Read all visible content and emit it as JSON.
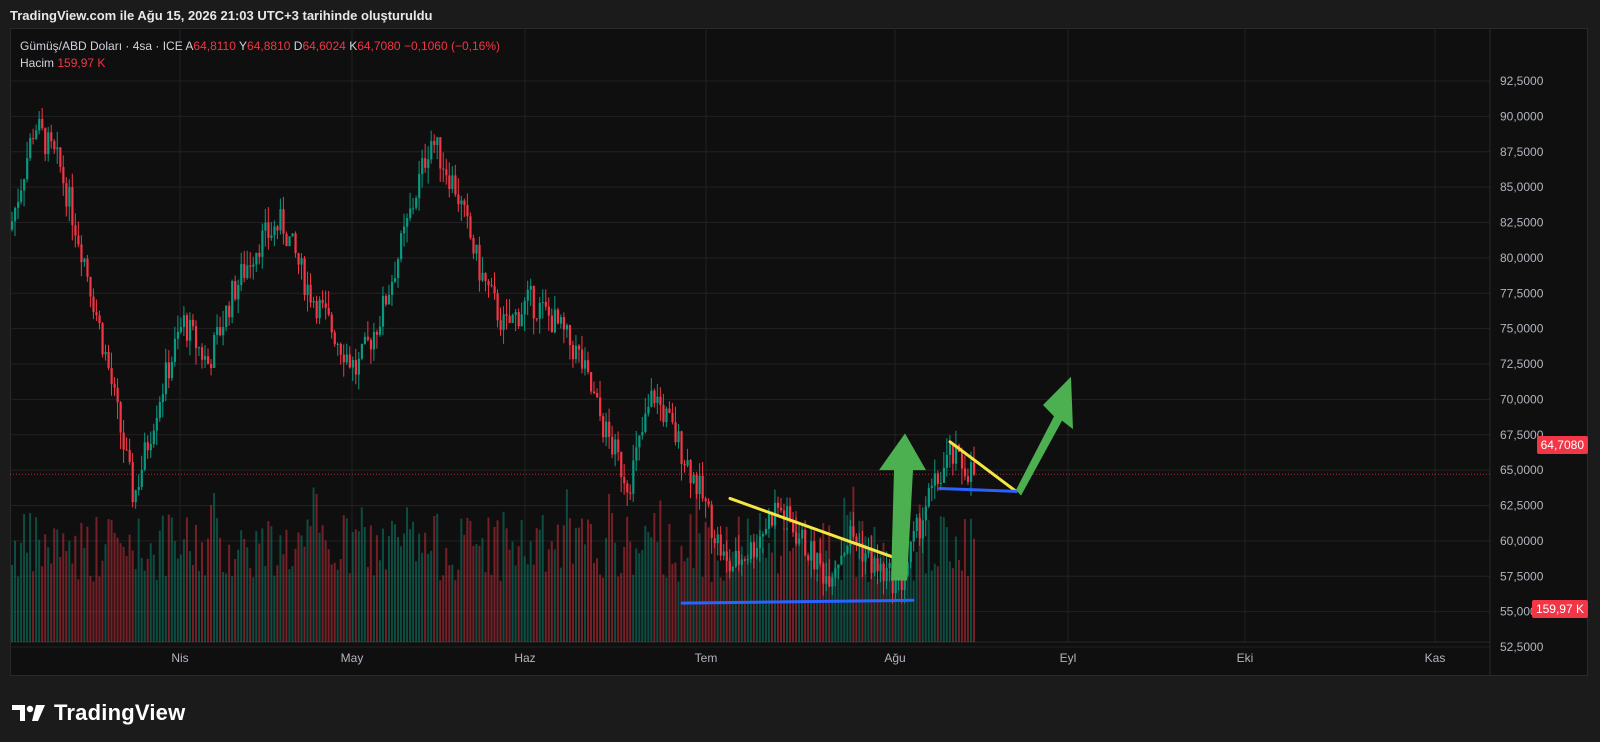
{
  "header": {
    "title": "TradingView.com ile Ağu 15, 2026 21:03 UTC+3 tarihinde oluşturuldu"
  },
  "legend": {
    "symbol": "Gümüş/ABD Doları · 4sa · ICE",
    "open_label": "A",
    "open": "64,8110",
    "high_label": "Y",
    "high": "64,8810",
    "low_label": "D",
    "low": "64,6024",
    "close_label": "K",
    "close": "64,7080",
    "change": "−0,1060 (−0,16%)",
    "volume_label": "Hacim",
    "volume": "159,97 K"
  },
  "price_tag": "64,7080",
  "volume_tag": "159,97 K",
  "brand": {
    "name": "TradingView",
    "logo_icon": "tradingview-logo-icon"
  },
  "colors": {
    "up": "#089981",
    "down": "#f23645",
    "trend": "#f5e642",
    "support": "#2962ff",
    "arrow": "#4caf50"
  },
  "chart_data": {
    "type": "candlestick",
    "y_axis": {
      "min": 52.5,
      "max": 92.5,
      "ticks": [
        "92,5000",
        "90,0000",
        "87,5000",
        "85,0000",
        "82,5000",
        "80,0000",
        "77,5000",
        "75,0000",
        "72,5000",
        "70,0000",
        "67,5000",
        "65,0000",
        "62,5000",
        "60,0000",
        "57,5000",
        "55,0000",
        "52,5000"
      ]
    },
    "x_axis": {
      "ticks": [
        "Nis",
        "May",
        "Haz",
        "Tem",
        "Ağu",
        "Eyl",
        "Eki",
        "Kas"
      ]
    },
    "last_price": 64.708,
    "approx_path": [
      [
        "Mar",
        82.0
      ],
      [
        "Mar",
        89.5
      ],
      [
        "Mar",
        86.5
      ],
      [
        "Mar",
        80.0
      ],
      [
        "Mar",
        72.0
      ],
      [
        "Mar",
        63.0
      ],
      [
        "Nis",
        70.0
      ],
      [
        "Nis",
        75.5
      ],
      [
        "Nis",
        72.5
      ],
      [
        "Nis",
        77.5
      ],
      [
        "Nis",
        81.0
      ],
      [
        "Nis",
        82.5
      ],
      [
        "May",
        78.0
      ],
      [
        "May",
        75.0
      ],
      [
        "May",
        72.0
      ],
      [
        "May",
        76.0
      ],
      [
        "May",
        82.0
      ],
      [
        "May",
        88.5
      ],
      [
        "May",
        85.0
      ],
      [
        "May",
        79.0
      ],
      [
        "Haz",
        75.0
      ],
      [
        "Haz",
        77.0
      ],
      [
        "Haz",
        75.5
      ],
      [
        "Haz",
        73.0
      ],
      [
        "Haz",
        68.0
      ],
      [
        "Haz",
        64.0
      ],
      [
        "Haz",
        70.5
      ],
      [
        "Haz",
        67.0
      ],
      [
        "Haz",
        63.0
      ],
      [
        "Tem",
        58.0
      ],
      [
        "Tem",
        59.5
      ],
      [
        "Tem",
        62.5
      ],
      [
        "Tem",
        60.0
      ],
      [
        "Tem",
        57.5
      ],
      [
        "Tem",
        60.5
      ],
      [
        "Tem",
        58.0
      ],
      [
        "Ağu",
        57.0
      ],
      [
        "Ağu",
        62.5
      ],
      [
        "Ağu",
        66.0
      ],
      [
        "Ağu",
        64.7
      ]
    ],
    "annotations": [
      {
        "type": "trendline",
        "color": "yellow",
        "from": [
          "Tem",
          63.0
        ],
        "to": [
          "Ağu",
          58.6
        ]
      },
      {
        "type": "support",
        "color": "blue",
        "from": [
          "Tem",
          55.6
        ],
        "to": [
          "Ağu",
          55.8
        ]
      },
      {
        "type": "arrow-up",
        "color": "green",
        "from": [
          "Ağu",
          57.0
        ],
        "to": [
          "Ağu",
          67.5
        ]
      },
      {
        "type": "trendline",
        "color": "yellow",
        "from": [
          "Ağu",
          67.0
        ],
        "to": [
          "Ağu",
          63.5
        ]
      },
      {
        "type": "support",
        "color": "blue",
        "from": [
          "Ağu",
          63.7
        ],
        "to": [
          "Ağu",
          63.5
        ]
      },
      {
        "type": "arrow-up",
        "color": "green",
        "from": [
          "Ağu",
          63.5
        ],
        "to": [
          "Eyl",
          71.5
        ]
      }
    ]
  }
}
